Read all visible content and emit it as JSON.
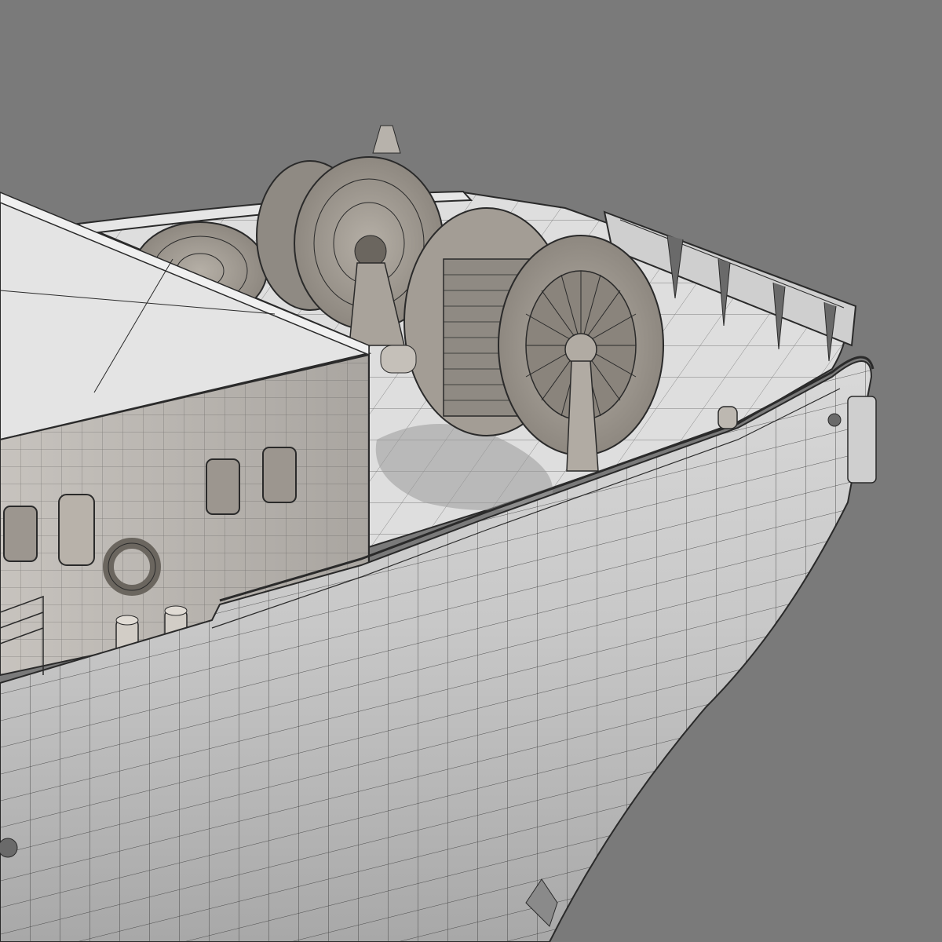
{
  "scene": {
    "subject": "ship-bow-wireframe-render",
    "background_color": "#7a7a7a",
    "hull_color": "#c9c9c9",
    "deck_color": "#dedede",
    "wire_color": "#2a2a2a",
    "winch_color": "#a09a92",
    "deckhouse_color": "#b3afaa"
  }
}
